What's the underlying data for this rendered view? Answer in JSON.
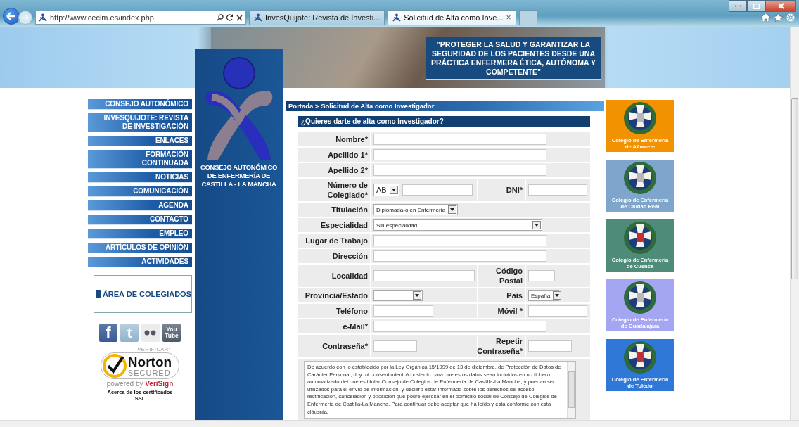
{
  "browser": {
    "address": "http://www.ceclm.es/index.php",
    "tabs": [
      {
        "label": "InvesQuijote: Revista de Investi...",
        "selected": false
      },
      {
        "label": "Solicitud de Alta como Inve...",
        "selected": true
      }
    ],
    "tab_close": "×"
  },
  "header": {
    "slogan": "\"PROTEGER LA SALUD Y GARANTIZAR LA SEGURIDAD DE LOS PACIENTES DESDE UNA PRÁCTICA ENFERMERA ÉTICA, AUTÓNOMA Y COMPETENTE\""
  },
  "logo": {
    "lines": [
      "CONSEJO AUTONÓMICO",
      "DE ENFERMERÍA DE",
      "CASTILLA - LA MANCHA"
    ]
  },
  "nav": {
    "items": [
      {
        "label": "CONSEJO AUTONÓMICO"
      },
      {
        "label": "INVESQUIJOTE: REVISTA\nDE INVESTIGACIÓN"
      },
      {
        "label": "ENLACES"
      },
      {
        "label": "FORMACIÓN\nCONTINUADA"
      },
      {
        "label": "NOTICIAS"
      },
      {
        "label": "COMUNICACIÓN"
      },
      {
        "label": "AGENDA"
      },
      {
        "label": "CONTACTO"
      },
      {
        "label": "EMPLEO"
      },
      {
        "label": "ARTÍCULOS DE OPINIÓN"
      },
      {
        "label": "ACTIVIDADES"
      }
    ],
    "area": "ÁREA DE COLEGIADOS"
  },
  "social": [
    {
      "kind": "facebook",
      "label": "f"
    },
    {
      "kind": "twitter",
      "label": "t"
    },
    {
      "kind": "flickr"
    },
    {
      "kind": "youtube",
      "label": "You Tube"
    }
  ],
  "norton": {
    "verify": "VERIFICAR›",
    "brand": "Norton",
    "secured": "SECURED",
    "powered": "powered by",
    "vendor": "VeriSign",
    "note": "Acerca de los certificados\nSSL"
  },
  "breadcrumb": "Portada > Solicitud de Alta como Investigador",
  "form": {
    "title": "¿Quieres darte de alta como Investigador?",
    "rows": [
      {
        "fields": [
          {
            "label": "Nombre*",
            "kind": "text"
          }
        ]
      },
      {
        "fields": [
          {
            "label": "Apellido 1*",
            "kind": "text"
          }
        ]
      },
      {
        "fields": [
          {
            "label": "Apellido 2*",
            "kind": "text"
          }
        ]
      },
      {
        "fields": [
          {
            "label": "Número de Colegiado*",
            "kind": "select-text",
            "value": "AB"
          },
          {
            "label": "DNI*",
            "kind": "text"
          }
        ]
      },
      {
        "fields": [
          {
            "label": "Titulación",
            "kind": "select",
            "value": "Diplomada-o en Enfermería"
          }
        ]
      },
      {
        "fields": [
          {
            "label": "Especialidad",
            "kind": "select",
            "value": "Sin especialidad"
          }
        ]
      },
      {
        "fields": [
          {
            "label": "Lugar de Trabajo",
            "kind": "text"
          }
        ]
      },
      {
        "fields": [
          {
            "label": "Dirección",
            "kind": "text"
          }
        ]
      },
      {
        "fields": [
          {
            "label": "Localidad",
            "kind": "text"
          },
          {
            "label": "Código Postal",
            "kind": "text"
          }
        ]
      },
      {
        "fields": [
          {
            "label": "Provincia/Estado",
            "kind": "select"
          },
          {
            "label": "Pais",
            "kind": "select",
            "value": "España"
          }
        ]
      },
      {
        "fields": [
          {
            "label": "Teléfono",
            "kind": "text"
          },
          {
            "label": "Móvil *",
            "kind": "text"
          }
        ]
      },
      {
        "fields": [
          {
            "label": "e-Mail*",
            "kind": "text"
          }
        ]
      },
      {
        "fields": [
          {
            "label": "Contraseña*",
            "kind": "text"
          },
          {
            "label": "Repetir Contraseña*",
            "kind": "text"
          }
        ]
      }
    ],
    "consent": "De acuerdo con lo establecido por la Ley Orgánica 15/1999 de 13 de diciembre, de Protección de Datos de Carácter Personal, doy mi consentimiento/consiento para que estos datos sean incluidos en un fichero automatizado del que es titular Consejo de Colegios de Enfermería de Castilla-La Mancha, y puedan ser utilizados para el envío de información, y declaro estar informado sobre los derechos de acceso, rectificación, cancelación y oposición que podré ejercitar en el domicilio social de Consejo de Colegios de Enfermería de Castilla-La Mancha. Para continuar debe aceptar que ha leído y está conforme con esta cláusula."
  },
  "colleges": [
    {
      "name": "Colegio de Enfermería\nde Albacete",
      "color": "#f39200"
    },
    {
      "name": "Colegio de Enfermería\nde Ciudad Real",
      "color": "#7ea6cc"
    },
    {
      "name": "Colegio de Enfermería\nde Cuenca",
      "color": "#4f8b79"
    },
    {
      "name": "Colegio de Enfermería\nde Guadalajara",
      "color": "#a5a6f2"
    },
    {
      "name": "Colegio de Enfermería\nde Toledo",
      "color": "#2f78d8"
    }
  ]
}
